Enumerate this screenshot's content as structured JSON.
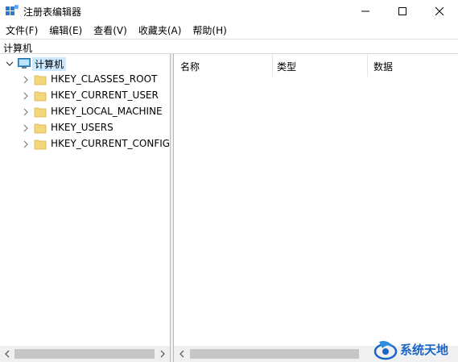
{
  "window": {
    "title": "注册表编辑器"
  },
  "menu": {
    "items": [
      {
        "label": "文件(F)"
      },
      {
        "label": "编辑(E)"
      },
      {
        "label": "查看(V)"
      },
      {
        "label": "收藏夹(A)"
      },
      {
        "label": "帮助(H)"
      }
    ]
  },
  "address": {
    "path": "计算机"
  },
  "tree": {
    "root": {
      "label": "计算机",
      "expanded": true,
      "selected": true,
      "icon": "computer-icon"
    },
    "children": [
      {
        "label": "HKEY_CLASSES_ROOT",
        "icon": "folder-icon"
      },
      {
        "label": "HKEY_CURRENT_USER",
        "icon": "folder-icon"
      },
      {
        "label": "HKEY_LOCAL_MACHINE",
        "icon": "folder-icon"
      },
      {
        "label": "HKEY_USERS",
        "icon": "folder-icon"
      },
      {
        "label": "HKEY_CURRENT_CONFIG",
        "icon": "folder-icon"
      }
    ]
  },
  "list": {
    "columns": [
      {
        "label": "名称"
      },
      {
        "label": "类型"
      },
      {
        "label": "数据"
      }
    ]
  },
  "watermark": {
    "text": "系统天地"
  },
  "colors": {
    "selection": "#cce8ff",
    "folder": "#f3d77a",
    "watermark": "#1a66c8"
  }
}
